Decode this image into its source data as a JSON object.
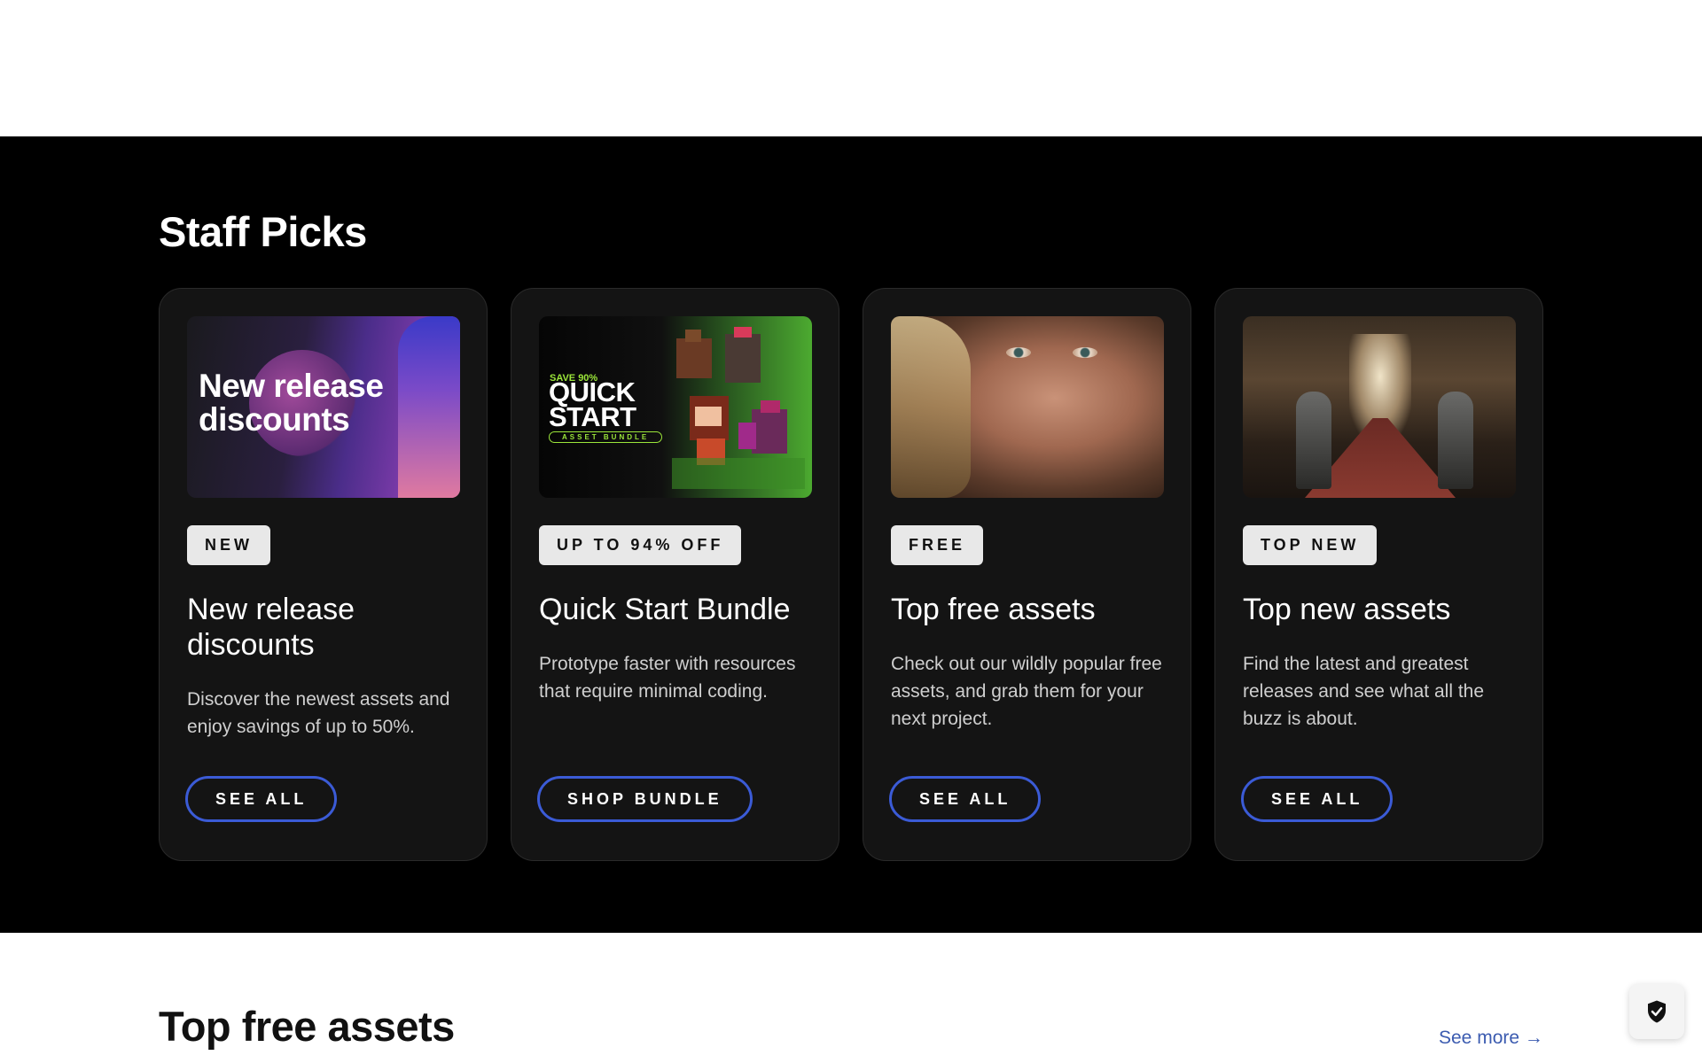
{
  "staff_picks": {
    "title": "Staff Picks",
    "cards": [
      {
        "image_text": "New release discounts",
        "badge": "NEW",
        "title": "New release discounts",
        "description": "Discover the newest assets and enjoy savings of up to 50%.",
        "button": "SEE ALL"
      },
      {
        "image_save": "SAVE 90%",
        "image_title": "QUICK START",
        "image_pill": "ASSET BUNDLE",
        "badge": "UP TO 94% OFF",
        "title": "Quick Start Bundle",
        "description": "Prototype faster with resources that require minimal coding.",
        "button": "SHOP BUNDLE"
      },
      {
        "badge": "FREE",
        "title": "Top free assets",
        "description": "Check out our wildly popular free assets, and grab them for your next project.",
        "button": "SEE ALL"
      },
      {
        "badge": "TOP NEW",
        "title": "Top new assets",
        "description": "Find the latest and greatest releases and see what all the buzz is about.",
        "button": "SEE ALL"
      }
    ]
  },
  "top_free": {
    "title": "Top free assets",
    "see_more": "See more →"
  },
  "icons": {
    "privacy": "shield-check-icon"
  },
  "colors": {
    "button_border": "#3b5bd6",
    "link": "#3b5bb0",
    "section_bg": "#000000",
    "card_bg": "#141414"
  }
}
